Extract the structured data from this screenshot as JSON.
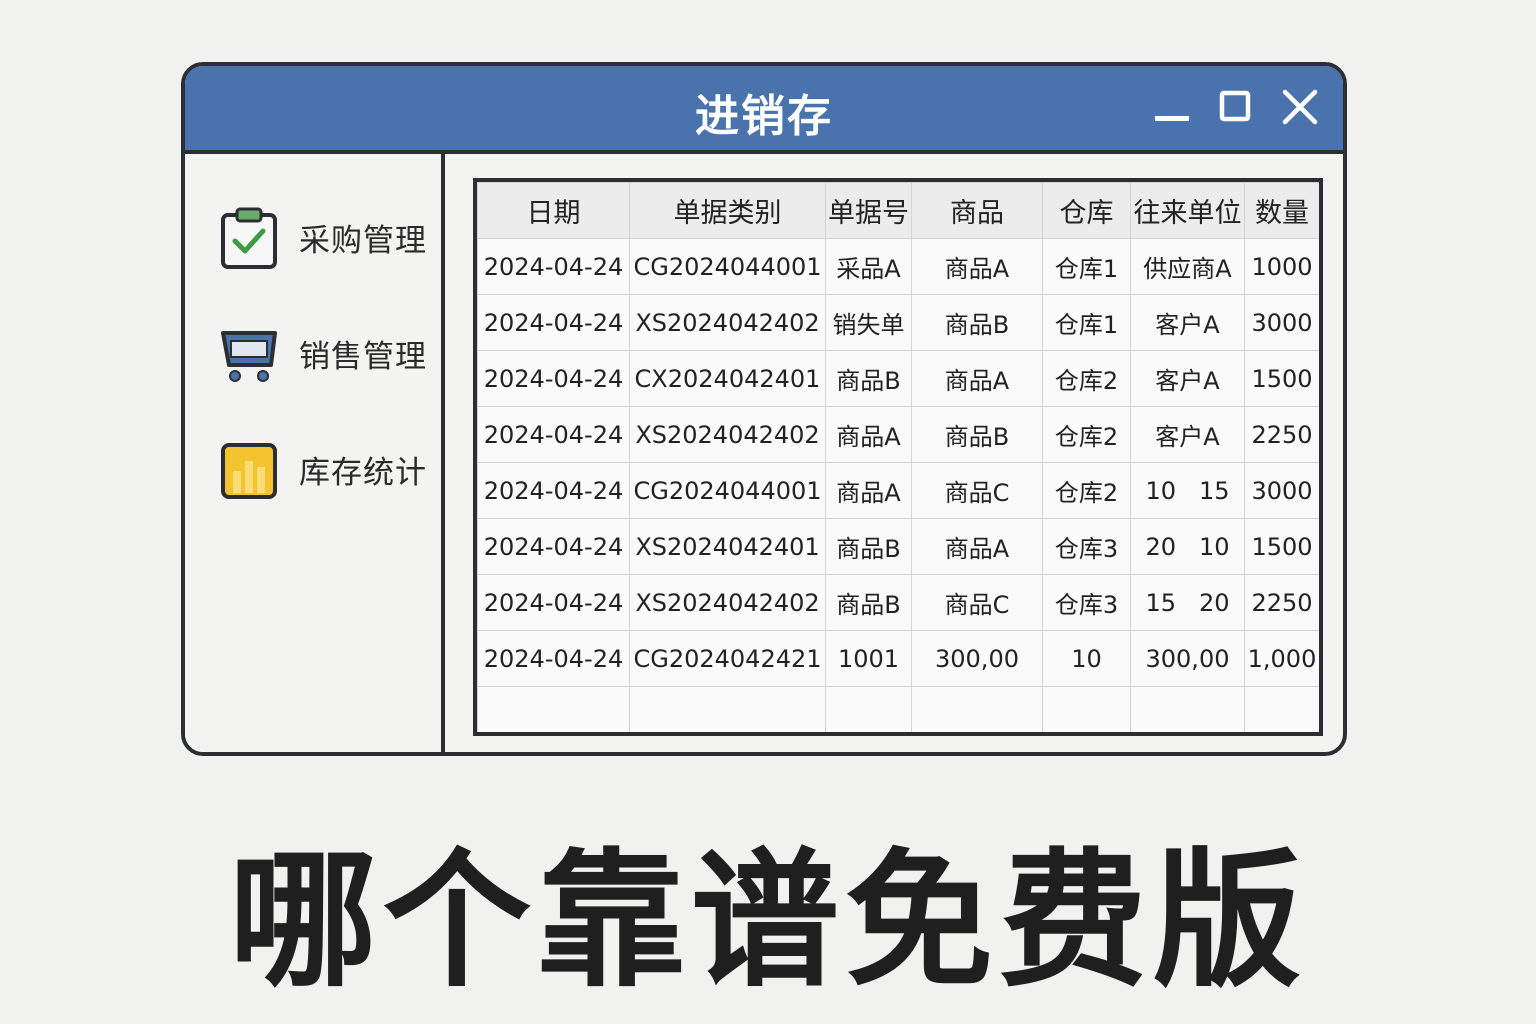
{
  "window": {
    "title": "进销存",
    "title_color": "#ffffff",
    "titlebar_color": "#4a72ad"
  },
  "controls": {
    "minimize_icon": "minimize-icon",
    "maximize_icon": "maximize-icon",
    "close_icon": "close-icon"
  },
  "sidebar": {
    "items": [
      {
        "label": "采购管理",
        "icon": "clipboard-check-icon"
      },
      {
        "label": "销售管理",
        "icon": "shopping-cart-icon"
      },
      {
        "label": "库存统计",
        "icon": "inventory-box-icon"
      }
    ]
  },
  "table": {
    "headers": [
      "日期",
      "单据类别",
      "单据号",
      "商品",
      "仓库",
      "往来单位",
      "数量"
    ],
    "rows": [
      [
        "2024-04-24",
        "CG2024044001",
        "采品A",
        "商品A",
        "仓库1",
        "供应商A",
        "1000"
      ],
      [
        "2024-04-24",
        "XS2024042402",
        "销失单",
        "商品B",
        "仓库1",
        "客户A",
        "3000"
      ],
      [
        "2024-04-24",
        "CX2024042401",
        "商品B",
        "商品A",
        "仓库2",
        "客户A",
        "1500"
      ],
      [
        "2024-04-24",
        "XS2024042402",
        "商品A",
        "商品B",
        "仓库2",
        "客户A",
        "2250"
      ],
      [
        "2024-04-24",
        "CG2024044001",
        "商品A",
        "商品C",
        "仓库2",
        "10   15",
        "3000"
      ],
      [
        "2024-04-24",
        "XS2024042401",
        "商品B",
        "商品A",
        "仓库3",
        "20   10",
        "1500"
      ],
      [
        "2024-04-24",
        "XS2024042402",
        "商品B",
        "商品C",
        "仓库3",
        "15   20",
        "2250"
      ],
      [
        "2024-04-24",
        "CG2024042421",
        "1001",
        "300,00",
        "10",
        "300,00",
        "1,000"
      ]
    ]
  },
  "headline": "哪个靠谱免费版"
}
